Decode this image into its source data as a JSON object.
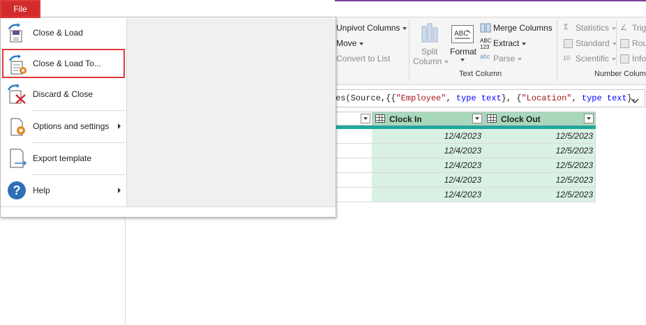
{
  "colors": {
    "accent_red": "#d12b2b",
    "teal": "#1fa89d",
    "header_green": "#a8d8bb",
    "cell_green": "#d9f1e3"
  },
  "file_tab": {
    "label": "File"
  },
  "file_menu": {
    "items": [
      {
        "label": "Close & Load",
        "icon": "close-load-icon",
        "submenu": false
      },
      {
        "label": "Close & Load To...",
        "icon": "close-load-to-icon",
        "submenu": false,
        "selected": true
      },
      {
        "label": "Discard & Close",
        "icon": "discard-close-icon",
        "submenu": false
      },
      {
        "label": "Options and settings",
        "icon": "options-settings-icon",
        "submenu": true
      },
      {
        "label": "Export template",
        "icon": "export-template-icon",
        "submenu": false
      },
      {
        "label": "Help",
        "icon": "help-icon",
        "submenu": true
      }
    ]
  },
  "ribbon": {
    "unpivot": "Unpivot Columns",
    "move": "Move",
    "convert": "Convert to List",
    "split_line1": "Split",
    "split_line2": "Column",
    "format": "Format",
    "merge": "Merge Columns",
    "extract": "Extract",
    "parse": "Parse",
    "text_group": "Text Column",
    "statistics": "Statistics",
    "standard": "Standard",
    "scientific": "Scientific",
    "number_group": "Number Colum",
    "trig": "Trig",
    "round": "Rou",
    "info": "Info",
    "abc_text": "ABC",
    "abc_123": "123",
    "abc_small": "abc",
    "sci_prefix": "10"
  },
  "formula": {
    "p1": "es(Source,{{",
    "s1": "\"Employee\"",
    "p2": ", ",
    "k1": "type text",
    "p3": "}, {",
    "s2": "\"Location\"",
    "p4": ", ",
    "k2": "type text",
    "p5": "},"
  },
  "table": {
    "columns": [
      "Clock In",
      "Clock Out"
    ],
    "rows": [
      [
        "12/4/2023",
        "12/5/2023"
      ],
      [
        "12/4/2023",
        "12/5/2023"
      ],
      [
        "12/4/2023",
        "12/5/2023"
      ],
      [
        "12/4/2023",
        "12/5/2023"
      ],
      [
        "12/4/2023",
        "12/5/2023"
      ]
    ]
  }
}
